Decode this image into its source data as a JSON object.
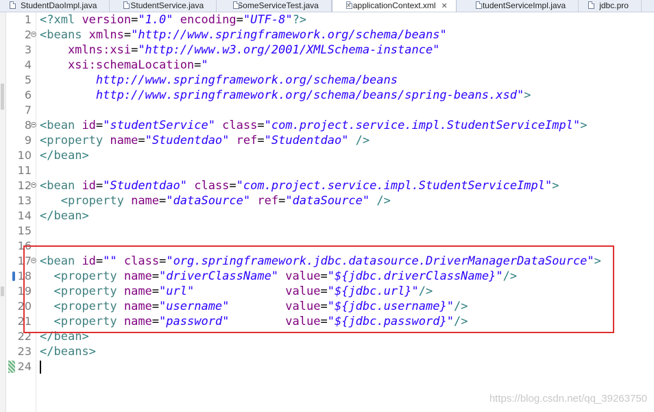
{
  "tabs": [
    {
      "label": "StudentDaoImpl.java",
      "icon": "java-file-icon",
      "active": false
    },
    {
      "label": "StudentService.java",
      "icon": "java-file-icon",
      "active": false
    },
    {
      "label": "SomeServiceTest.java",
      "icon": "java-file-icon",
      "active": false
    },
    {
      "label": "applicationContext.xml",
      "icon": "xml-file-icon",
      "active": true,
      "close": "✕"
    },
    {
      "label": "StudentServiceImpl.java",
      "icon": "java-file-icon",
      "active": false
    },
    {
      "label": "jdbc.pro",
      "icon": "properties-file-icon",
      "active": false
    }
  ],
  "editor": {
    "lines": [
      {
        "n": "1",
        "t": [
          [
            "tb",
            "<?"
          ],
          [
            "tn",
            "xml "
          ],
          [
            "an",
            "version"
          ],
          [
            "eq",
            "="
          ],
          [
            "av",
            "\"1.0\""
          ],
          [
            "an",
            " encoding"
          ],
          [
            "eq",
            "="
          ],
          [
            "av",
            "\"UTF-8\""
          ],
          [
            "tb",
            "?>"
          ]
        ]
      },
      {
        "n": "2",
        "fold": true,
        "t": [
          [
            "tb",
            "<"
          ],
          [
            "tn",
            "beans "
          ],
          [
            "an",
            "xmlns"
          ],
          [
            "eq",
            "="
          ],
          [
            "av",
            "\"http://www.springframework.org/schema/beans\""
          ]
        ]
      },
      {
        "n": "3",
        "t": [
          [
            "an",
            "    xmlns:xsi"
          ],
          [
            "eq",
            "="
          ],
          [
            "av",
            "\"http://www.w3.org/2001/XMLSchema-instance\""
          ]
        ]
      },
      {
        "n": "4",
        "t": [
          [
            "an",
            "    xsi:schemaLocation"
          ],
          [
            "eq",
            "="
          ],
          [
            "av",
            "\""
          ]
        ]
      },
      {
        "n": "5",
        "t": [
          [
            "av",
            "        http://www.springframework.org/schema/beans"
          ]
        ]
      },
      {
        "n": "6",
        "t": [
          [
            "av",
            "        http://www.springframework.org/schema/beans/spring-beans.xsd\""
          ],
          [
            "tb",
            ">"
          ]
        ]
      },
      {
        "n": "7",
        "t": []
      },
      {
        "n": "8",
        "fold": true,
        "t": [
          [
            "tb",
            "<"
          ],
          [
            "tn",
            "bean "
          ],
          [
            "an",
            "id"
          ],
          [
            "eq",
            "="
          ],
          [
            "av",
            "\"studentService\""
          ],
          [
            "an",
            " class"
          ],
          [
            "eq",
            "="
          ],
          [
            "av",
            "\"com.project.service.impl.StudentServiceImpl\""
          ],
          [
            "tb",
            ">"
          ]
        ]
      },
      {
        "n": "9",
        "t": [
          [
            "tb",
            "<"
          ],
          [
            "tn",
            "property "
          ],
          [
            "an",
            "name"
          ],
          [
            "eq",
            "="
          ],
          [
            "av",
            "\"Studentdao\""
          ],
          [
            "an",
            " ref"
          ],
          [
            "eq",
            "="
          ],
          [
            "av",
            "\"Studentdao\""
          ],
          [
            "tb",
            " />"
          ]
        ]
      },
      {
        "n": "10",
        "t": [
          [
            "tb",
            "</"
          ],
          [
            "tn",
            "bean"
          ],
          [
            "tb",
            ">"
          ]
        ]
      },
      {
        "n": "11",
        "t": []
      },
      {
        "n": "12",
        "fold": true,
        "t": [
          [
            "tb",
            "<"
          ],
          [
            "tn",
            "bean "
          ],
          [
            "an",
            "id"
          ],
          [
            "eq",
            "="
          ],
          [
            "av",
            "\"Studentdao\""
          ],
          [
            "an",
            " class"
          ],
          [
            "eq",
            "="
          ],
          [
            "av",
            "\"com.project.service.impl.StudentServiceImpl\""
          ],
          [
            "tb",
            ">"
          ]
        ]
      },
      {
        "n": "13",
        "t": [
          [
            "tb",
            "   <"
          ],
          [
            "tn",
            "property "
          ],
          [
            "an",
            "name"
          ],
          [
            "eq",
            "="
          ],
          [
            "av",
            "\"dataSource\""
          ],
          [
            "an",
            " ref"
          ],
          [
            "eq",
            "="
          ],
          [
            "av",
            "\"dataSource\""
          ],
          [
            "tb",
            " />"
          ]
        ]
      },
      {
        "n": "14",
        "t": [
          [
            "tb",
            "</"
          ],
          [
            "tn",
            "bean"
          ],
          [
            "tb",
            ">"
          ]
        ]
      },
      {
        "n": "15",
        "t": []
      },
      {
        "n": "16",
        "t": []
      },
      {
        "n": "17",
        "fold": true,
        "t": [
          [
            "tb",
            "<"
          ],
          [
            "tn",
            "bean "
          ],
          [
            "an",
            "id"
          ],
          [
            "eq",
            "="
          ],
          [
            "av",
            "\"\""
          ],
          [
            "an",
            " class"
          ],
          [
            "eq",
            "="
          ],
          [
            "av",
            "\"org.springframework.jdbc.datasource.DriverManagerDataSource\""
          ],
          [
            "tb",
            ">"
          ]
        ]
      },
      {
        "n": "18",
        "mark": "blue",
        "t": [
          [
            "tb",
            "  <"
          ],
          [
            "tn",
            "property "
          ],
          [
            "an",
            "name"
          ],
          [
            "eq",
            "="
          ],
          [
            "av",
            "\"driverClassName\""
          ],
          [
            "an",
            " value"
          ],
          [
            "eq",
            "="
          ],
          [
            "av",
            "\"${jdbc.driverClassName}\""
          ],
          [
            "tb",
            "/>"
          ]
        ]
      },
      {
        "n": "19",
        "t": [
          [
            "tb",
            "  <"
          ],
          [
            "tn",
            "property "
          ],
          [
            "an",
            "name"
          ],
          [
            "eq",
            "="
          ],
          [
            "av",
            "\"url\"            "
          ],
          [
            "an",
            " value"
          ],
          [
            "eq",
            "="
          ],
          [
            "av",
            "\"${jdbc.url}\""
          ],
          [
            "tb",
            "/>"
          ]
        ]
      },
      {
        "n": "20",
        "t": [
          [
            "tb",
            "  <"
          ],
          [
            "tn",
            "property "
          ],
          [
            "an",
            "name"
          ],
          [
            "eq",
            "="
          ],
          [
            "av",
            "\"username\"       "
          ],
          [
            "an",
            " value"
          ],
          [
            "eq",
            "="
          ],
          [
            "av",
            "\"${jdbc.username}\""
          ],
          [
            "tb",
            "/>"
          ]
        ]
      },
      {
        "n": "21",
        "t": [
          [
            "tb",
            "  <"
          ],
          [
            "tn",
            "property "
          ],
          [
            "an",
            "name"
          ],
          [
            "eq",
            "="
          ],
          [
            "av",
            "\"password\"       "
          ],
          [
            "an",
            " value"
          ],
          [
            "eq",
            "="
          ],
          [
            "av",
            "\"${jdbc.password}\""
          ],
          [
            "tb",
            "/>"
          ]
        ]
      },
      {
        "n": "22",
        "t": [
          [
            "tb",
            "</"
          ],
          [
            "tn",
            "bean"
          ],
          [
            "tb",
            ">"
          ]
        ]
      },
      {
        "n": "23",
        "t": [
          [
            "tb",
            "</"
          ],
          [
            "tn",
            "beans"
          ],
          [
            "tb",
            ">"
          ]
        ]
      },
      {
        "n": "24",
        "mark": "green",
        "caret": true,
        "t": []
      }
    ]
  },
  "watermark": "https://blog.csdn.net/qq_39263750",
  "colors": {
    "tag_bracket": "#2e7d7d",
    "tag_name": "#3f7f7f",
    "attr_name": "#7f007f",
    "attr_value": "#2a00ff",
    "highlight_box": "#e02f2f"
  }
}
